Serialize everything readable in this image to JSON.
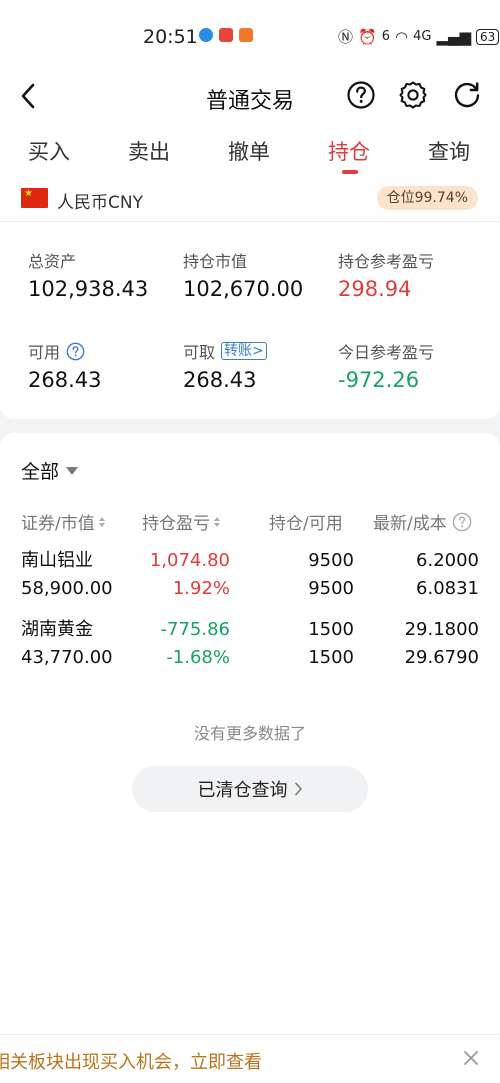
{
  "status_bar": {
    "time": "20:51",
    "network_label": "4G",
    "signal_label": "6",
    "battery": "63",
    "app_icon_colors": [
      "#2b8be8",
      "#e8443a",
      "#f07a2a"
    ]
  },
  "header": {
    "title": "普通交易",
    "back_icon": "chevron-left-icon",
    "help_icon": "question-circle-icon",
    "settings_icon": "gear-icon",
    "refresh_icon": "refresh-icon"
  },
  "tabs": [
    {
      "label": "买入",
      "active": false
    },
    {
      "label": "卖出",
      "active": false
    },
    {
      "label": "撤单",
      "active": false
    },
    {
      "label": "持仓",
      "active": true
    },
    {
      "label": "查询",
      "active": false
    }
  ],
  "currency": {
    "label": "人民币CNY",
    "flag": "china-flag",
    "position_ratio": "仓位99.74%"
  },
  "summary": {
    "total_assets_label": "总资产",
    "total_assets": "102,938.43",
    "market_value_label": "持仓市值",
    "market_value": "102,670.00",
    "position_pnl_label": "持仓参考盈亏",
    "position_pnl": "298.94",
    "available_label": "可用",
    "available": "268.43",
    "withdrawable_label": "可取",
    "withdrawable": "268.43",
    "transfer_label": "转账>",
    "today_pnl_label": "今日参考盈亏",
    "today_pnl": "-972.26"
  },
  "holdings": {
    "filter_label": "全部",
    "columns": {
      "security": "证券/市值",
      "pnl": "持仓盈亏",
      "quantity": "持仓/可用",
      "price": "最新/成本"
    },
    "rows": [
      {
        "name": "南山铝业",
        "market_value": "58,900.00",
        "pnl": "1,074.80",
        "pnl_pct": "1.92%",
        "position": "9500",
        "available": "9500",
        "latest": "6.2000",
        "cost": "6.0831",
        "trend": "up"
      },
      {
        "name": "湖南黄金",
        "market_value": "43,770.00",
        "pnl": "-775.86",
        "pnl_pct": "-1.68%",
        "position": "1500",
        "available": "1500",
        "latest": "29.1800",
        "cost": "29.6790",
        "trend": "down"
      }
    ],
    "no_more_text": "没有更多数据了",
    "cleared_query_label": "已清仓查询"
  },
  "banner": {
    "text": "相关板块出现买入机会，立即查看"
  },
  "colors": {
    "accent_red": "#e03c3c",
    "gain_red": "#e03c3c",
    "loss_green": "#17a361",
    "badge_bg": "#fde3cc",
    "link_blue": "#3a7bd5",
    "banner_text": "#b8741a"
  }
}
